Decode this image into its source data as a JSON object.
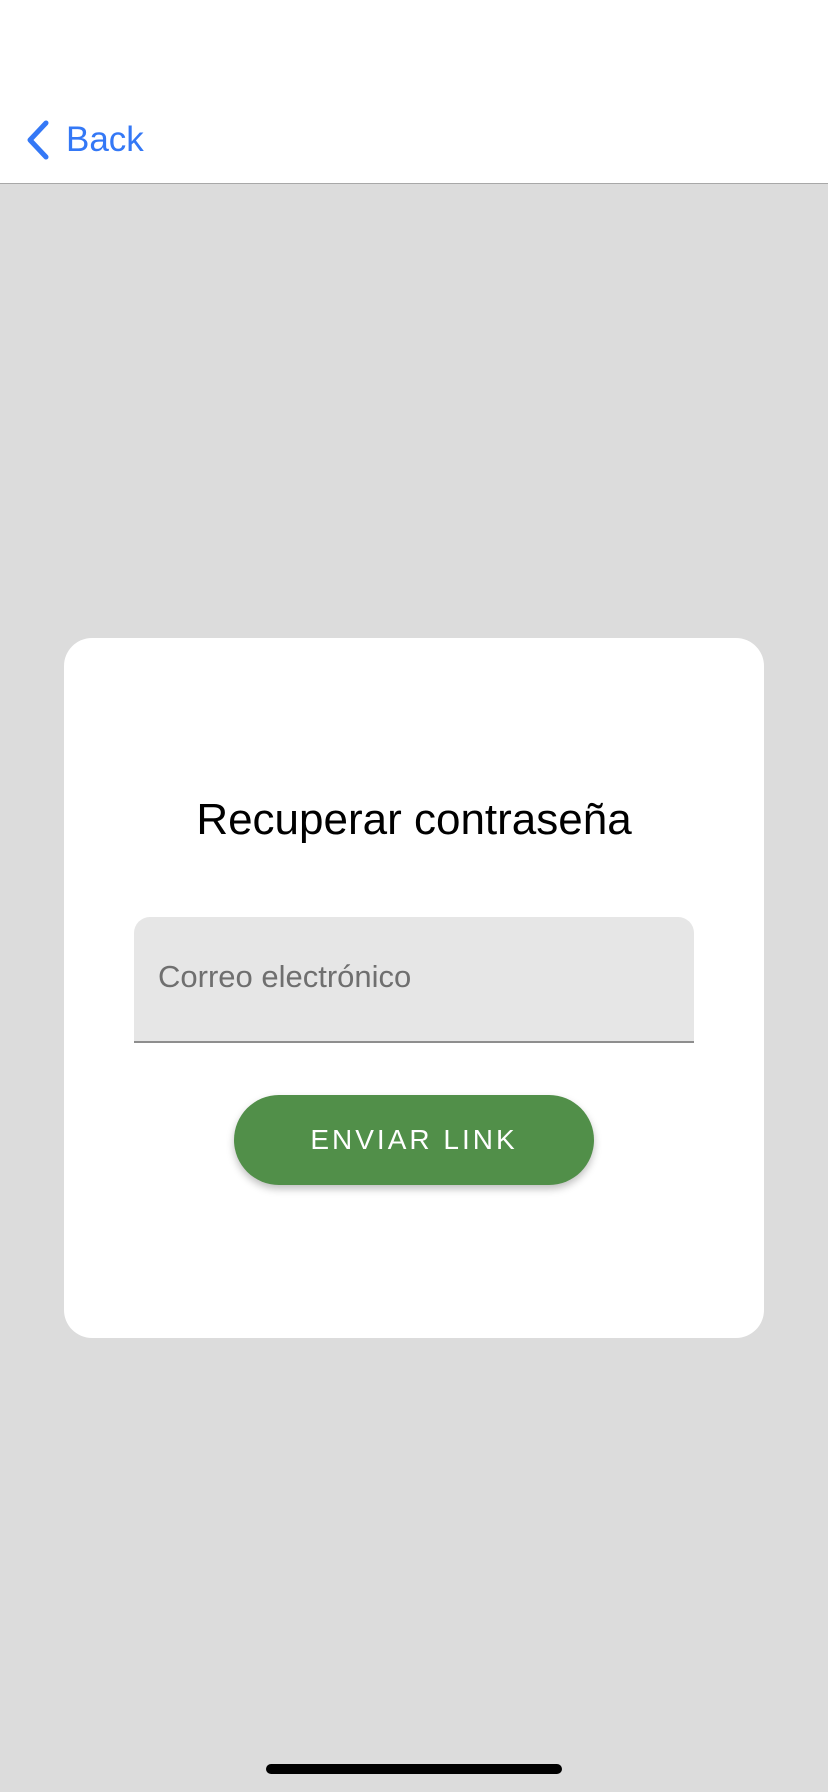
{
  "nav": {
    "back_label": "Back",
    "back_icon": "chevron-left-icon",
    "accent_color": "#3478f6"
  },
  "card": {
    "title": "Recuperar contraseña",
    "email_placeholder": "Correo electrónico",
    "email_value": "",
    "send_label": "ENVIAR LINK",
    "button_color": "#518f49"
  }
}
